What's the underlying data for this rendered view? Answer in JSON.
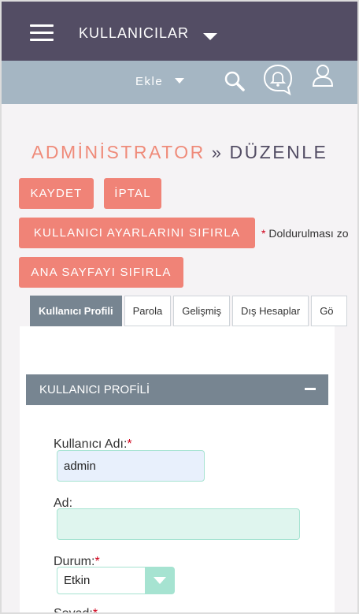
{
  "header": {
    "module_title": "KULLANICILAR",
    "add_label": "Ekle",
    "icons": [
      "menu-icon",
      "search-icon",
      "notification-bell-icon",
      "user-icon"
    ]
  },
  "breadcrumb": {
    "parent": "ADMİNİSTRATOR",
    "separator": "»",
    "current": "DÜZENLE"
  },
  "actions": {
    "save": "KAYDET",
    "cancel": "İPTAL",
    "reset_user_settings": "KULLANICI AYARLARINI SIFIRLA",
    "reset_homepage": "ANA SAYFAYI SIFIRLA",
    "required_note": "Doldurulması zo"
  },
  "tabs": [
    {
      "label": "Kullanıcı Profili",
      "active": true
    },
    {
      "label": "Parola",
      "active": false
    },
    {
      "label": "Gelişmiş",
      "active": false
    },
    {
      "label": "Dış Hesaplar",
      "active": false
    },
    {
      "label": "Gö",
      "active": false
    }
  ],
  "section": {
    "title": "KULLANICI PROFİLİ"
  },
  "form": {
    "username_label": "Kullanıcı Adı:",
    "username_value": "admin",
    "name_label": "Ad:",
    "name_value": "",
    "status_label": "Durum:",
    "status_value": "Etkin",
    "next_label": "Soyad:"
  },
  "colors": {
    "topbar": "#534d64",
    "subbar": "#a5b6c3",
    "accent": "#f08377",
    "section": "#778591",
    "field_border": "#a6e3d1"
  }
}
